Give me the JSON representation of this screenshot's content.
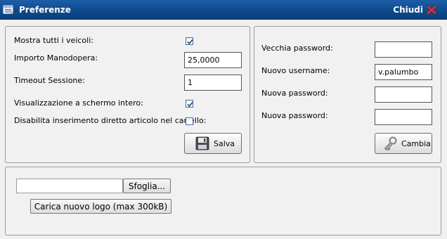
{
  "window": {
    "title": "Preferenze",
    "close_label": "Chiudi",
    "app_icon": "window-settings-icon",
    "close_icon": "red-x-icon"
  },
  "preferences": {
    "show_all_vehicles": {
      "label": "Mostra tutti i veicoli:",
      "checked": true
    },
    "labor_cost": {
      "label": "Importo Manodopera:",
      "value": "25,0000"
    },
    "session_timeout": {
      "label": "Timeout Sessione:",
      "value": "1"
    },
    "fullscreen": {
      "label": "Visualizzazione a schermo intero:",
      "checked": true
    },
    "disable_direct_insert": {
      "label": "Disabilita inserimento diretto articolo nel carrello:",
      "checked": false
    },
    "save_button": {
      "label": "Salva",
      "icon": "floppy-disk-icon"
    }
  },
  "account": {
    "old_password": {
      "label": "Vecchia password:",
      "value": ""
    },
    "new_username": {
      "label": "Nuovo username:",
      "value": "v.palumbo"
    },
    "new_password": {
      "label": "Nuova password:",
      "value": ""
    },
    "confirm_password": {
      "label": "Nuova password:",
      "value": ""
    },
    "change_button": {
      "label": "Cambia",
      "icon": "key-icon"
    }
  },
  "logo_upload": {
    "file_value": "",
    "browse_label": "Sfoglia...",
    "upload_label": "Carica nuovo logo (max 300kB)"
  },
  "colors": {
    "titlebar": "#0f4a8c",
    "panel_background": "#f1f1f1",
    "close_icon": "#d42a2a"
  }
}
